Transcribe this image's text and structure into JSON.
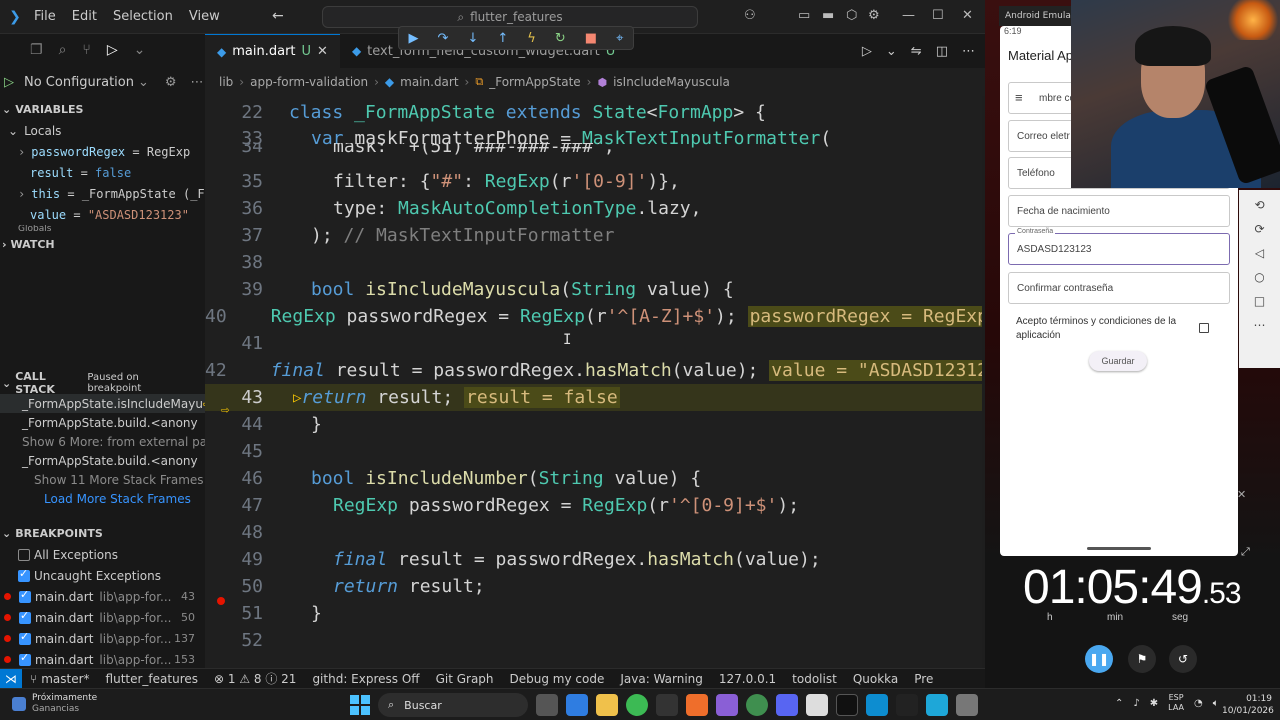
{
  "titlebar": {
    "menus": [
      "File",
      "Edit",
      "Selection",
      "View"
    ],
    "search_text": "flutter_features"
  },
  "sidebar": {
    "run_config": "No Configuration",
    "variables_title": "VARIABLES",
    "locals_title": "Locals",
    "locals": [
      {
        "name": "passwordRegex",
        "value": "RegExp",
        "kind": "plain",
        "expandable": true
      },
      {
        "name": "result",
        "value": "false",
        "kind": "kw",
        "expandable": false
      },
      {
        "name": "this",
        "value": "_FormAppState (_F...",
        "kind": "plain",
        "expandable": true
      },
      {
        "name": "value",
        "value": "\"ASDASD123123\"",
        "kind": "str",
        "expandable": false
      }
    ],
    "globals_title": "Globals",
    "watch_title": "WATCH",
    "callstack_title": "CALL STACK",
    "callstack_status": "Paused on breakpoint",
    "stack": [
      {
        "label": "_FormAppState.isIncludeMayu",
        "style": "top"
      },
      {
        "label": "_FormAppState.build.<anony",
        "style": "normal"
      },
      {
        "label": "Show 6 More: from external pack",
        "style": "dim"
      },
      {
        "label": "_FormAppState.build.<anony",
        "style": "normal"
      },
      {
        "label": "Show 11 More Stack Frames",
        "style": "dim"
      },
      {
        "label": "Load More Stack Frames",
        "style": "link"
      }
    ],
    "breakpoints_title": "BREAKPOINTS",
    "bp_options": [
      {
        "label": "All Exceptions",
        "checked": false
      },
      {
        "label": "Uncaught Exceptions",
        "checked": true
      }
    ],
    "breakpoints": [
      {
        "file": "main.dart",
        "path": "lib\\app-for...",
        "line": "43"
      },
      {
        "file": "main.dart",
        "path": "lib\\app-for...",
        "line": "50"
      },
      {
        "file": "main.dart",
        "path": "lib\\app-for...",
        "line": "137"
      },
      {
        "file": "main.dart",
        "path": "lib\\app-for...",
        "line": "153"
      }
    ]
  },
  "tabs": [
    {
      "label": "main.dart",
      "status": "U",
      "active": true
    },
    {
      "label": "text_form_field_custom_widget.dart",
      "status": "U",
      "active": false
    }
  ],
  "breadcrumb": [
    "lib",
    "app-form-validation",
    "main.dart",
    "_FormAppState",
    "isIncludeMayuscula"
  ],
  "code": {
    "l22": {
      "n": "22",
      "a": "class ",
      "b": "_FormAppState",
      "c": " extends ",
      "d": "State",
      "e": "<",
      "f": "FormApp",
      "g": "> {"
    },
    "l33": {
      "n": "33",
      "a": "var ",
      "b": "maskFormatterPhone = ",
      "c": "MaskTextInputFormatter",
      "d": "("
    },
    "l34": {
      "n": "34",
      "a": "mask: '+(51) ###-###-###',"
    },
    "l35": {
      "n": "35",
      "a": "filter: {",
      "b": "\"#\"",
      "c": ": ",
      "d": "RegExp",
      "e": "(r",
      "f": "'[0-9]'",
      "g": ")},"
    },
    "l36": {
      "n": "36",
      "a": "type: ",
      "b": "MaskAutoCompletionType",
      "c": ".lazy,"
    },
    "l37": {
      "n": "37",
      "a": "); ",
      "b": "// MaskTextInputFormatter"
    },
    "l38": {
      "n": "38"
    },
    "l39": {
      "n": "39",
      "a": "bool ",
      "b": "isIncludeMayuscula",
      "c": "(",
      "d": "String",
      "e": " value) {"
    },
    "l40": {
      "n": "40",
      "a": "RegExp",
      "b": " passwordRegex = ",
      "c": "RegExp",
      "d": "(r",
      "e": "'^[A-Z]+$'",
      "f": "); ",
      "g": "passwordRegex = RegExp"
    },
    "l41": {
      "n": "41"
    },
    "l42": {
      "n": "42",
      "a": "final",
      "b": " result = passwordRegex.",
      "c": "hasMatch",
      "d": "(value); ",
      "e": "value = \"ASDASD123123\""
    },
    "l43": {
      "n": "43",
      "a": "return",
      "b": " result; ",
      "c": "result = false"
    },
    "l44": {
      "n": "44",
      "a": "}"
    },
    "l45": {
      "n": "45"
    },
    "l46": {
      "n": "46",
      "a": "bool ",
      "b": "isIncludeNumber",
      "c": "(",
      "d": "String",
      "e": " value) {"
    },
    "l47": {
      "n": "47",
      "a": "RegExp",
      "b": " passwordRegex = ",
      "c": "RegExp",
      "d": "(r",
      "e": "'^[0-9]+$'",
      "f": ");"
    },
    "l48": {
      "n": "48"
    },
    "l49": {
      "n": "49",
      "a": "final",
      "b": " result = passwordRegex.",
      "c": "hasMatch",
      "d": "(value);"
    },
    "l50": {
      "n": "50",
      "a": "return",
      "b": " result;"
    },
    "l51": {
      "n": "51",
      "a": "}"
    },
    "l52": {
      "n": "52"
    }
  },
  "statusbar": {
    "branch": "master*",
    "project": "flutter_features",
    "problems": "⊗ 1 ⚠ 8 ⓘ 21",
    "items": [
      "githd: Express Off",
      "Git Graph",
      "Debug my code",
      "Java: Warning",
      "127.0.0.1",
      "todolist",
      "Quokka",
      "Pre"
    ]
  },
  "emulator": {
    "window_title": "Android Emulator",
    "time": "6:19",
    "app_title": "Material Ap",
    "fields": [
      {
        "label": "",
        "value": "mbre com"
      },
      {
        "label": "",
        "value": "Correo eletr"
      },
      {
        "label": "",
        "value": "Teléfono"
      },
      {
        "label": "",
        "value": "Fecha de nacimiento"
      },
      {
        "label": "Contraseña",
        "value": "ASDASD123123"
      },
      {
        "label": "",
        "value": "Confirmar contraseña"
      }
    ],
    "terms": "Acepto términos y condiciones de la aplicación",
    "save": "Guardar"
  },
  "timer": {
    "main": "01:05:49",
    "fraction": ".53",
    "units": [
      "h",
      "min",
      "seg"
    ]
  },
  "taskbar": {
    "news_title": "Próximamente",
    "news_sub": "Ganancias",
    "search": "Buscar",
    "lang_top": "ESP",
    "lang_bottom": "LAA",
    "clock_time": "01:19",
    "clock_date": "10/01/2026"
  },
  "colors": {
    "accent": "#0078d4",
    "breakpoint": "#e51400",
    "current_line": "#4b4b18"
  }
}
